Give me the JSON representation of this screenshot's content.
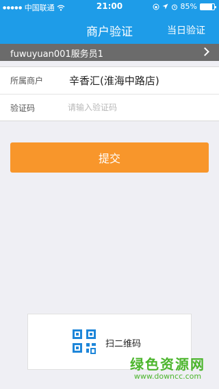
{
  "status_bar": {
    "carrier": "中国联通",
    "time": "21:00",
    "battery": "85%",
    "battery_level": 0.85
  },
  "nav": {
    "title": "商户验证",
    "right_action": "当日验证"
  },
  "account": {
    "label": "fuwuyuan001服务员1"
  },
  "form": {
    "merchant_label": "所属商户",
    "merchant_value": "辛香汇(淮海中路店)",
    "code_label": "验证码",
    "code_placeholder": "请输入验证码",
    "code_value": ""
  },
  "submit": {
    "label": "提交"
  },
  "scan": {
    "label": "扫二维码"
  },
  "watermark": {
    "name": "绿色资源网",
    "url": "www.downcc.com"
  },
  "colors": {
    "nav_blue": "#1e9ce8",
    "submit_orange": "#f8962b",
    "account_gray": "#6b6b6b",
    "qr_blue": "#1e86d9",
    "watermark_green": "#4bb52c"
  }
}
